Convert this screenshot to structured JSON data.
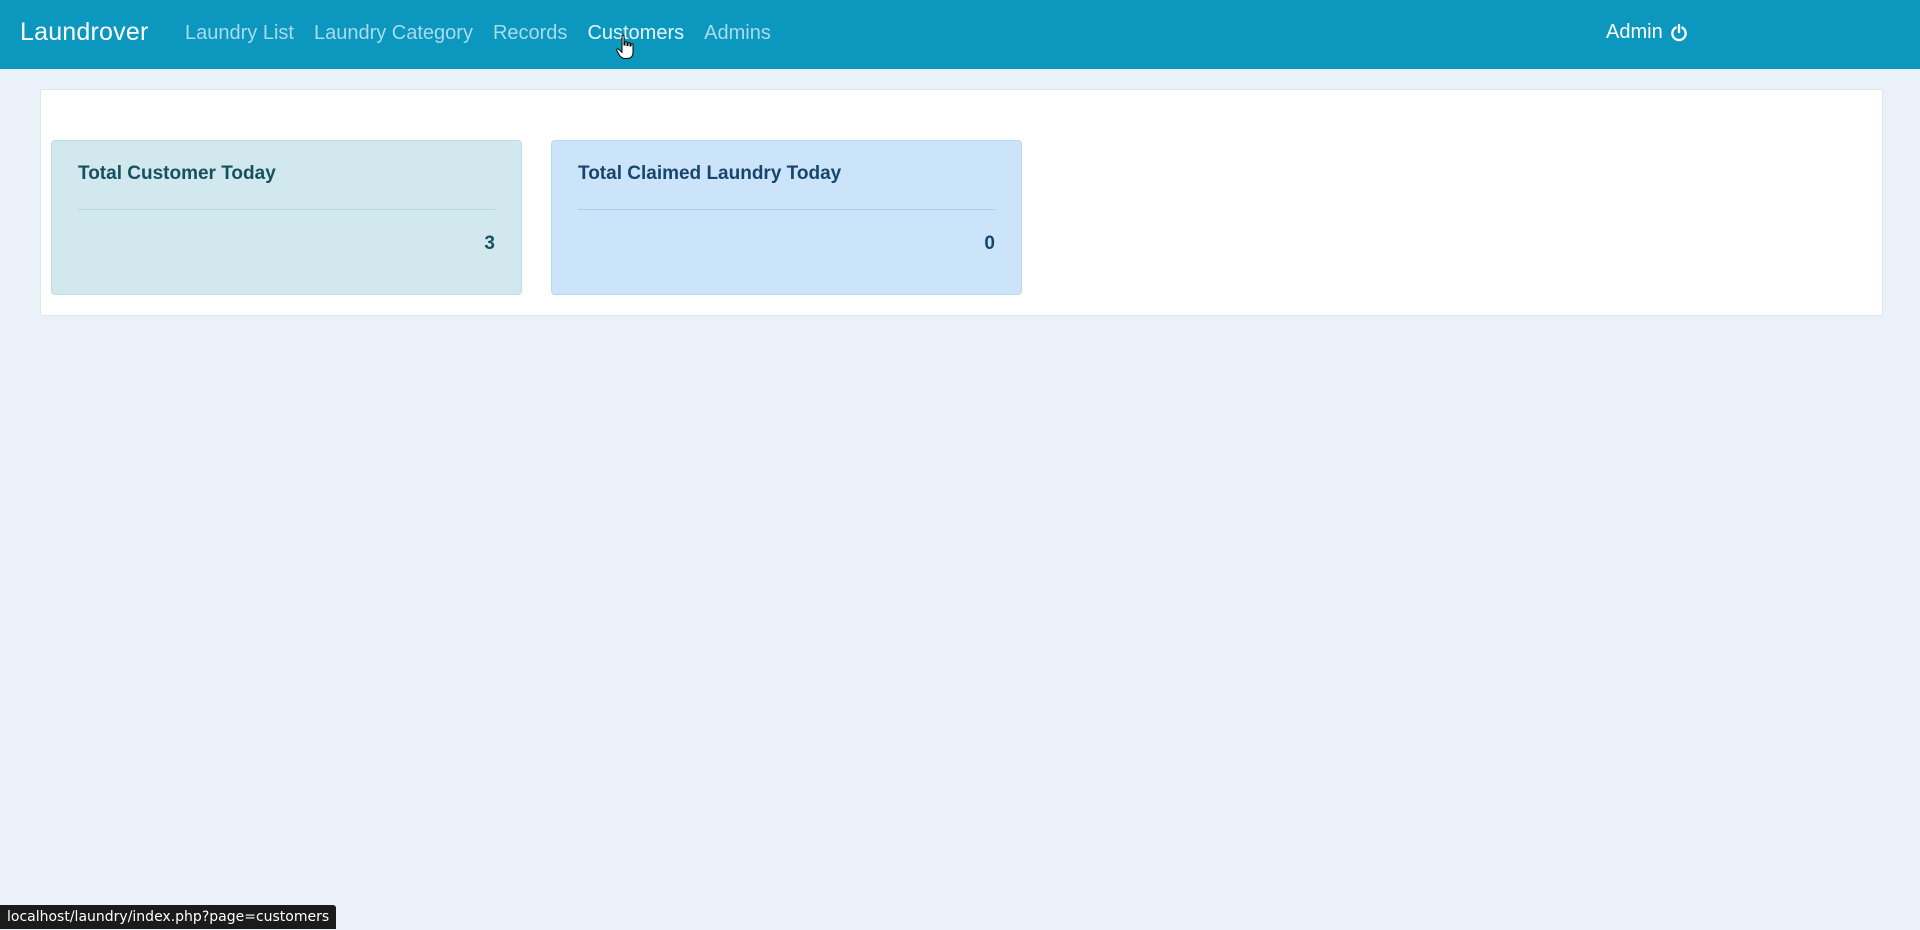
{
  "navbar": {
    "brand": "Laundrover",
    "links": [
      {
        "label": "Laundry List"
      },
      {
        "label": "Laundry Category"
      },
      {
        "label": "Records"
      },
      {
        "label": "Customers"
      },
      {
        "label": "Admins"
      }
    ],
    "user_label": "Admin",
    "user_icon": "power-icon",
    "bg_color": "#0c97bf"
  },
  "dashboard": {
    "cards": [
      {
        "title": "Total Customer Today",
        "value": "3",
        "color": "#d1e8ef"
      },
      {
        "title": "Total Claimed Laundry Today",
        "value": "0",
        "color": "#cce4f9"
      }
    ]
  },
  "status_bar": {
    "url": "localhost/laundry/index.php?page=customers"
  }
}
